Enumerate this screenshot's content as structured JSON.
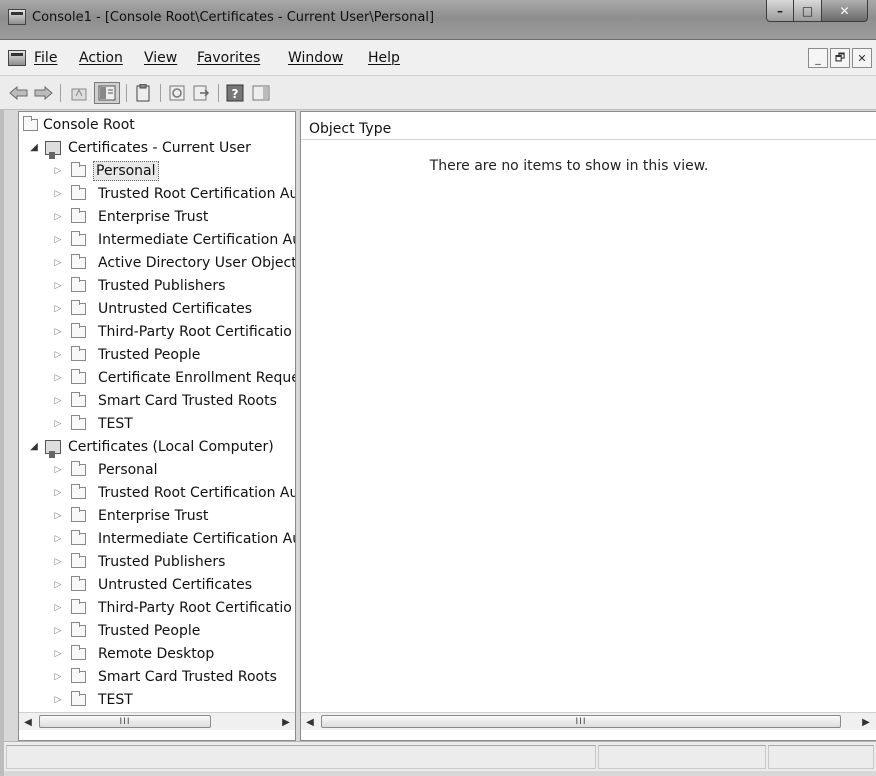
{
  "window": {
    "title": "Console1 - [Console Root\\Certificates - Current User\\Personal]",
    "minimize": "–",
    "maximize": "□",
    "close": "✕"
  },
  "menubar": {
    "items": [
      "File",
      "Action",
      "View",
      "Favorites",
      "Window",
      "Help"
    ],
    "mdi_minimize": "_",
    "mdi_restore": "🗗",
    "mdi_close": "✕"
  },
  "toolbar": {
    "buttons": [
      "back-icon",
      "forward-icon",
      "up-icon",
      "show-hide-tree-icon",
      "properties-icon",
      "refresh-icon",
      "export-list-icon",
      "help-icon",
      "show-hide-action-pane-icon"
    ]
  },
  "tree": {
    "root": "Console Root",
    "current_user": {
      "label": "Certificates - Current User",
      "children": [
        "Personal",
        "Trusted Root Certification Au",
        "Enterprise Trust",
        "Intermediate Certification Au",
        "Active Directory User Object",
        "Trusted Publishers",
        "Untrusted Certificates",
        "Third-Party Root Certificatio",
        "Trusted People",
        "Certificate Enrollment Reque",
        "Smart Card Trusted Roots",
        "TEST"
      ]
    },
    "local_computer": {
      "label": "Certificates (Local Computer)",
      "children": [
        "Personal",
        "Trusted Root Certification Au",
        "Enterprise Trust",
        "Intermediate Certification Au",
        "Trusted Publishers",
        "Untrusted Certificates",
        "Third-Party Root Certificatio",
        "Trusted People",
        "Remote Desktop",
        "Smart Card Trusted Roots",
        "TEST"
      ]
    },
    "selected": "Personal"
  },
  "list": {
    "column": "Object Type",
    "empty_message": "There are no items to show in this view."
  },
  "scroll": {
    "left_arrow": "◀",
    "right_arrow": "▶",
    "grip": "III"
  }
}
